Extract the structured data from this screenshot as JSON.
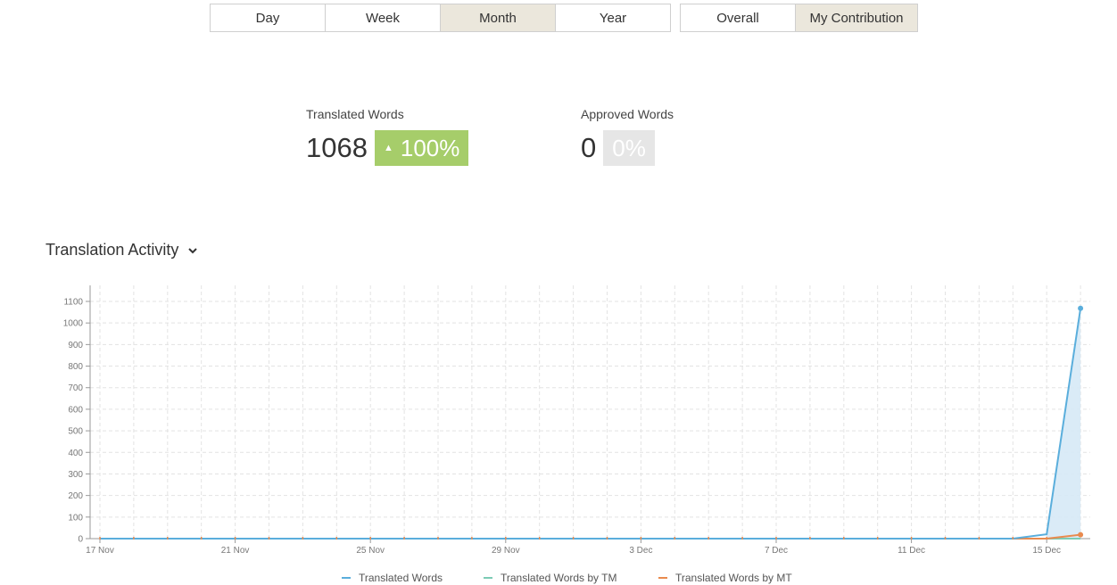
{
  "period_tabs": [
    {
      "label": "Day",
      "active": false
    },
    {
      "label": "Week",
      "active": false
    },
    {
      "label": "Month",
      "active": true
    },
    {
      "label": "Year",
      "active": false
    }
  ],
  "scope_tabs": [
    {
      "label": "Overall",
      "active": false
    },
    {
      "label": "My Contribution",
      "active": true
    }
  ],
  "metrics": {
    "translated": {
      "label": "Translated Words",
      "value": "1068",
      "change": "100%",
      "trend": "up"
    },
    "approved": {
      "label": "Approved Words",
      "value": "0",
      "change": "0%"
    }
  },
  "section_title": "Translation Activity",
  "colors": {
    "blue": "#5aaedc",
    "teal": "#7ccbb5",
    "orange": "#e98a4e",
    "green_badge": "#a6cd6a"
  },
  "chart_data": {
    "type": "line",
    "x_tick_labels": [
      "17 Nov",
      "21 Nov",
      "25 Nov",
      "29 Nov",
      "3 Dec",
      "7 Dec",
      "11 Dec",
      "15 Dec"
    ],
    "x": [
      "17 Nov",
      "18 Nov",
      "19 Nov",
      "20 Nov",
      "21 Nov",
      "22 Nov",
      "23 Nov",
      "24 Nov",
      "25 Nov",
      "26 Nov",
      "27 Nov",
      "28 Nov",
      "29 Nov",
      "30 Nov",
      "1 Dec",
      "2 Dec",
      "3 Dec",
      "4 Dec",
      "5 Dec",
      "6 Dec",
      "7 Dec",
      "8 Dec",
      "9 Dec",
      "10 Dec",
      "11 Dec",
      "12 Dec",
      "13 Dec",
      "14 Dec",
      "15 Dec",
      "16 Dec"
    ],
    "ylim": [
      0,
      1100
    ],
    "y_ticks": [
      0,
      100,
      200,
      300,
      400,
      500,
      600,
      700,
      800,
      900,
      1000,
      1100
    ],
    "grid": true,
    "series": [
      {
        "name": "Translated Words",
        "values": [
          0,
          0,
          0,
          0,
          0,
          0,
          0,
          0,
          0,
          0,
          0,
          0,
          0,
          0,
          0,
          0,
          0,
          0,
          0,
          0,
          0,
          0,
          0,
          0,
          0,
          0,
          0,
          0,
          20,
          1068
        ],
        "area": true
      },
      {
        "name": "Translated Words by TM",
        "values": [
          0,
          0,
          0,
          0,
          0,
          0,
          0,
          0,
          0,
          0,
          0,
          0,
          0,
          0,
          0,
          0,
          0,
          0,
          0,
          0,
          0,
          0,
          0,
          0,
          0,
          0,
          0,
          0,
          0,
          0
        ]
      },
      {
        "name": "Translated Words by MT",
        "values": [
          0,
          0,
          0,
          0,
          0,
          0,
          0,
          0,
          0,
          0,
          0,
          0,
          0,
          0,
          0,
          0,
          0,
          0,
          0,
          0,
          0,
          0,
          0,
          0,
          0,
          0,
          0,
          0,
          0,
          18
        ]
      }
    ],
    "legend": "bottom"
  }
}
